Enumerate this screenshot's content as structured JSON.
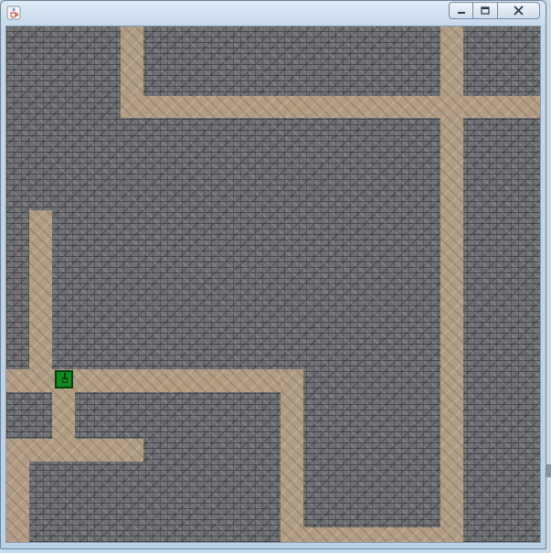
{
  "window": {
    "title": "",
    "minimize_icon": "minimize-icon",
    "maximize_icon": "maximize-icon",
    "close_icon": "close-icon",
    "app_icon": "java-cup-icon"
  },
  "game": {
    "ground_texture": "stone-brick",
    "road_texture": "sand-path",
    "player": {
      "kind": "tank",
      "color": "#138a1f",
      "facing": "up"
    }
  },
  "colors": {
    "stone": "#6f7174",
    "path": "#b19c84",
    "player": "#138a1f",
    "player_outline": "#063f0b"
  }
}
